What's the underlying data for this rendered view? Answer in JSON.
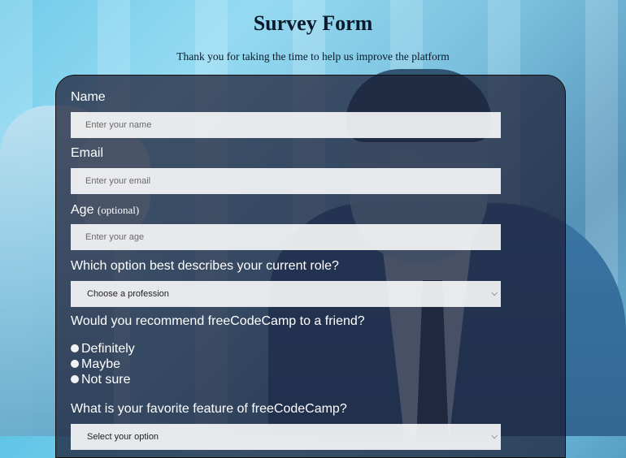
{
  "header": {
    "title": "Survey Form",
    "subtitle": "Thank you for taking the time to help us improve the platform"
  },
  "form": {
    "name_label": "Name",
    "name_placeholder": "Enter your name",
    "email_label": "Email",
    "email_placeholder": "Enter your email",
    "age_label": "Age",
    "age_optional": "(optional)",
    "age_placeholder": "Enter your age",
    "role_label": "Which option best describes your current role?",
    "role_selected": "Choose a profession",
    "recommend_label": "Would you recommend freeCodeCamp to a friend?",
    "recommend_options": [
      "Definitely",
      "Maybe",
      "Not sure"
    ],
    "feature_label": "What is your favorite feature of freeCodeCamp?",
    "feature_selected": "Select your option"
  }
}
